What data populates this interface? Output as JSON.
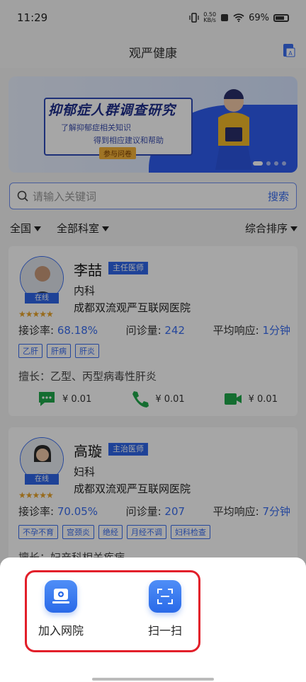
{
  "status_bar": {
    "time": "11:29",
    "net_speed": "0.50",
    "net_unit": "KB/s",
    "battery": "69%"
  },
  "header": {
    "title": "观严健康",
    "translate_icon": "translate-icon"
  },
  "banner": {
    "title": "抑郁症人群调查研究",
    "line1": "了解抑郁症相关知识",
    "line2": "得到相应建议和帮助",
    "button": "参与问卷"
  },
  "search": {
    "placeholder": "请输入关键词",
    "button": "搜索"
  },
  "filters": {
    "region": "全国",
    "department": "全部科室",
    "sort": "综合排序"
  },
  "doctors": [
    {
      "name": "李喆",
      "title": "主任医师",
      "dept": "内科",
      "hospital": "成都双流观严互联网医院",
      "status": "在线",
      "rating_stars": 5,
      "rate_label": "接诊率:",
      "rate": "68.18%",
      "count_label": "问诊量:",
      "count": "242",
      "resp_label": "平均响应:",
      "resp": "1分钟",
      "tags": [
        "乙肝",
        "肝病",
        "肝炎"
      ],
      "speciality": "擅长：乙型、丙型病毒性肝炎",
      "services": [
        {
          "icon": "chat-icon",
          "price": "¥ 0.01"
        },
        {
          "icon": "phone-icon",
          "price": "¥ 0.01"
        },
        {
          "icon": "video-icon",
          "price": "¥ 0.01"
        }
      ]
    },
    {
      "name": "高璇",
      "title": "主治医师",
      "dept": "妇科",
      "hospital": "成都双流观严互联网医院",
      "status": "在线",
      "rating_stars": 5,
      "rate_label": "接诊率:",
      "rate": "70.05%",
      "count_label": "问诊量:",
      "count": "207",
      "resp_label": "平均响应:",
      "resp": "7分钟",
      "tags": [
        "不孕不育",
        "宫颈炎",
        "绝经",
        "月经不调",
        "妇科检查"
      ],
      "speciality": "擅长：妇产科相关疾病"
    }
  ],
  "sheet": {
    "actions": [
      {
        "label": "加入网院",
        "icon": "hospital-join-icon"
      },
      {
        "label": "扫一扫",
        "icon": "scan-icon"
      }
    ]
  },
  "colors": {
    "primary": "#3a6df0",
    "highlight": "#e21f2a",
    "star": "#e8a32a",
    "service_green": "#1fa84a"
  }
}
